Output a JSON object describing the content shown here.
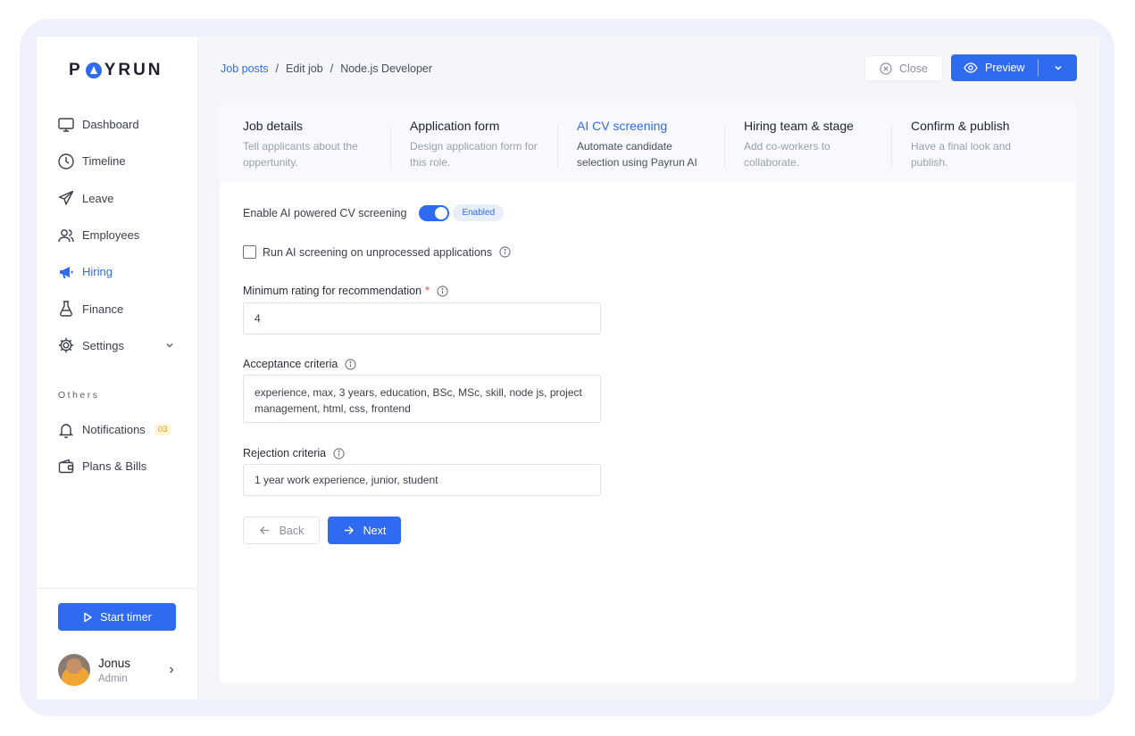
{
  "brand": {
    "logo_text_left": "P",
    "logo_text_right": "YRUN",
    "accent": "#2f6bf0"
  },
  "sidebar": {
    "items": [
      {
        "label": "Dashboard",
        "icon": "monitor-icon"
      },
      {
        "label": "Timeline",
        "icon": "clock-icon"
      },
      {
        "label": "Leave",
        "icon": "plane-icon"
      },
      {
        "label": "Employees",
        "icon": "users-icon"
      },
      {
        "label": "Hiring",
        "icon": "megaphone-icon",
        "active": true
      },
      {
        "label": "Finance",
        "icon": "flask-icon"
      },
      {
        "label": "Settings",
        "icon": "gear-icon"
      }
    ],
    "others_heading": "Others",
    "others_items": [
      {
        "label": "Notifications",
        "icon": "bell-icon",
        "badge": "03"
      },
      {
        "label": "Plans & Bills",
        "icon": "wallet-icon"
      }
    ],
    "start_timer_label": "Start timer",
    "user": {
      "name": "Jonus",
      "role": "Admin"
    }
  },
  "header": {
    "breadcrumb": {
      "root": "Job posts",
      "sep1": "/",
      "middle": "Edit job",
      "sep2": "/",
      "current": "Node.js Developer"
    },
    "close_label": "Close",
    "preview_label": "Preview"
  },
  "steps": [
    {
      "title": "Job details",
      "desc": "Tell applicants about the oppertunity."
    },
    {
      "title": "Application form",
      "desc": "Design application form for this role."
    },
    {
      "title": "AI CV screening",
      "desc": "Automate candidate selection using Payrun AI",
      "active": true
    },
    {
      "title": "Hiring team & stage",
      "desc": "Add co-workers to collaborate."
    },
    {
      "title": "Confirm & publish",
      "desc": "Have a final look and publish."
    }
  ],
  "form": {
    "enable_label": "Enable AI powered CV screening",
    "enable_status": "Enabled",
    "run_label": "Run AI screening on unprocessed applications",
    "min_rating_label": "Minimum rating for recommendation",
    "min_rating_required": "*",
    "min_rating_value": "4",
    "acceptance_label": "Acceptance criteria",
    "acceptance_value": "experience, max, 3 years, education, BSc, MSc, skill, node js, project management, html, css, frontend",
    "rejection_label": "Rejection criteria",
    "rejection_value": "1 year work experience, junior, student",
    "back_label": "Back",
    "next_label": "Next"
  }
}
